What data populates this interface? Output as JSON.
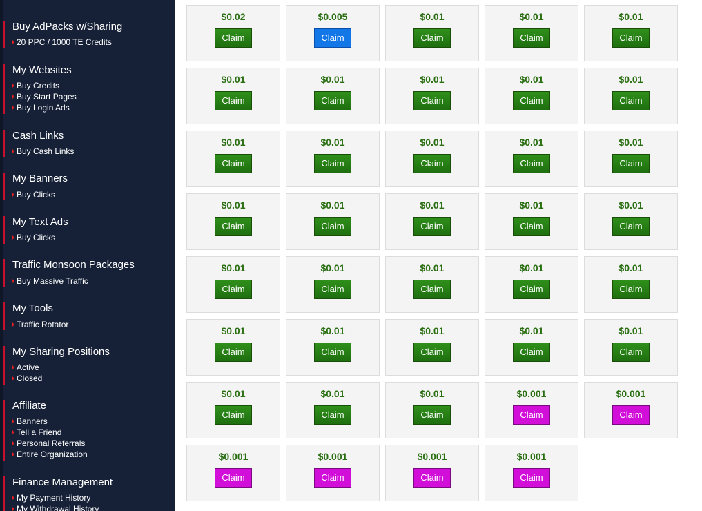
{
  "sidebar": {
    "sections": [
      {
        "title": "Buy AdPacks w/Sharing",
        "links": [
          "20 PPC / 1000 TE Credits"
        ]
      },
      {
        "title": "My Websites",
        "links": [
          "Buy Credits",
          "Buy Start Pages",
          "Buy Login Ads"
        ]
      },
      {
        "title": "Cash Links",
        "links": [
          "Buy Cash Links"
        ]
      },
      {
        "title": "My Banners",
        "links": [
          "Buy Clicks"
        ]
      },
      {
        "title": "My Text Ads",
        "links": [
          "Buy Clicks"
        ]
      },
      {
        "title": "Traffic Monsoon Packages",
        "links": [
          "Buy Massive Traffic"
        ]
      },
      {
        "title": "My Tools",
        "links": [
          "Traffic Rotator"
        ]
      },
      {
        "title": "My Sharing Positions",
        "links": [
          "Active",
          "Closed"
        ]
      },
      {
        "title": "Affiliate",
        "links": [
          "Banners",
          "Tell a Friend",
          "Personal Referrals",
          "Entire Organization"
        ]
      },
      {
        "title": "Finance Management",
        "links": [
          "My Payment History",
          "My Withdrawal History"
        ]
      }
    ]
  },
  "colors": {
    "sidebar_bg": "#162138",
    "claim_green": "#2a8a16",
    "claim_blue": "#1377e8",
    "claim_magenta": "#d10fd9",
    "amount_text": "#2a6e12"
  },
  "claims": [
    {
      "amount": "$0.02",
      "button": "Claim",
      "color": "green"
    },
    {
      "amount": "$0.005",
      "button": "Claim",
      "color": "blue"
    },
    {
      "amount": "$0.01",
      "button": "Claim",
      "color": "green"
    },
    {
      "amount": "$0.01",
      "button": "Claim",
      "color": "green"
    },
    {
      "amount": "$0.01",
      "button": "Claim",
      "color": "green"
    },
    {
      "amount": "$0.01",
      "button": "Claim",
      "color": "green"
    },
    {
      "amount": "$0.01",
      "button": "Claim",
      "color": "green"
    },
    {
      "amount": "$0.01",
      "button": "Claim",
      "color": "green"
    },
    {
      "amount": "$0.01",
      "button": "Claim",
      "color": "green"
    },
    {
      "amount": "$0.01",
      "button": "Claim",
      "color": "green"
    },
    {
      "amount": "$0.01",
      "button": "Claim",
      "color": "green"
    },
    {
      "amount": "$0.01",
      "button": "Claim",
      "color": "green"
    },
    {
      "amount": "$0.01",
      "button": "Claim",
      "color": "green"
    },
    {
      "amount": "$0.01",
      "button": "Claim",
      "color": "green"
    },
    {
      "amount": "$0.01",
      "button": "Claim",
      "color": "green"
    },
    {
      "amount": "$0.01",
      "button": "Claim",
      "color": "green"
    },
    {
      "amount": "$0.01",
      "button": "Claim",
      "color": "green"
    },
    {
      "amount": "$0.01",
      "button": "Claim",
      "color": "green"
    },
    {
      "amount": "$0.01",
      "button": "Claim",
      "color": "green"
    },
    {
      "amount": "$0.01",
      "button": "Claim",
      "color": "green"
    },
    {
      "amount": "$0.01",
      "button": "Claim",
      "color": "green"
    },
    {
      "amount": "$0.01",
      "button": "Claim",
      "color": "green"
    },
    {
      "amount": "$0.01",
      "button": "Claim",
      "color": "green"
    },
    {
      "amount": "$0.01",
      "button": "Claim",
      "color": "green"
    },
    {
      "amount": "$0.01",
      "button": "Claim",
      "color": "green"
    },
    {
      "amount": "$0.01",
      "button": "Claim",
      "color": "green"
    },
    {
      "amount": "$0.01",
      "button": "Claim",
      "color": "green"
    },
    {
      "amount": "$0.01",
      "button": "Claim",
      "color": "green"
    },
    {
      "amount": "$0.01",
      "button": "Claim",
      "color": "green"
    },
    {
      "amount": "$0.01",
      "button": "Claim",
      "color": "green"
    },
    {
      "amount": "$0.01",
      "button": "Claim",
      "color": "green"
    },
    {
      "amount": "$0.01",
      "button": "Claim",
      "color": "green"
    },
    {
      "amount": "$0.01",
      "button": "Claim",
      "color": "green"
    },
    {
      "amount": "$0.001",
      "button": "Claim",
      "color": "magenta"
    },
    {
      "amount": "$0.001",
      "button": "Claim",
      "color": "magenta"
    },
    {
      "amount": "$0.001",
      "button": "Claim",
      "color": "magenta"
    },
    {
      "amount": "$0.001",
      "button": "Claim",
      "color": "magenta"
    },
    {
      "amount": "$0.001",
      "button": "Claim",
      "color": "magenta"
    },
    {
      "amount": "$0.001",
      "button": "Claim",
      "color": "magenta"
    }
  ]
}
